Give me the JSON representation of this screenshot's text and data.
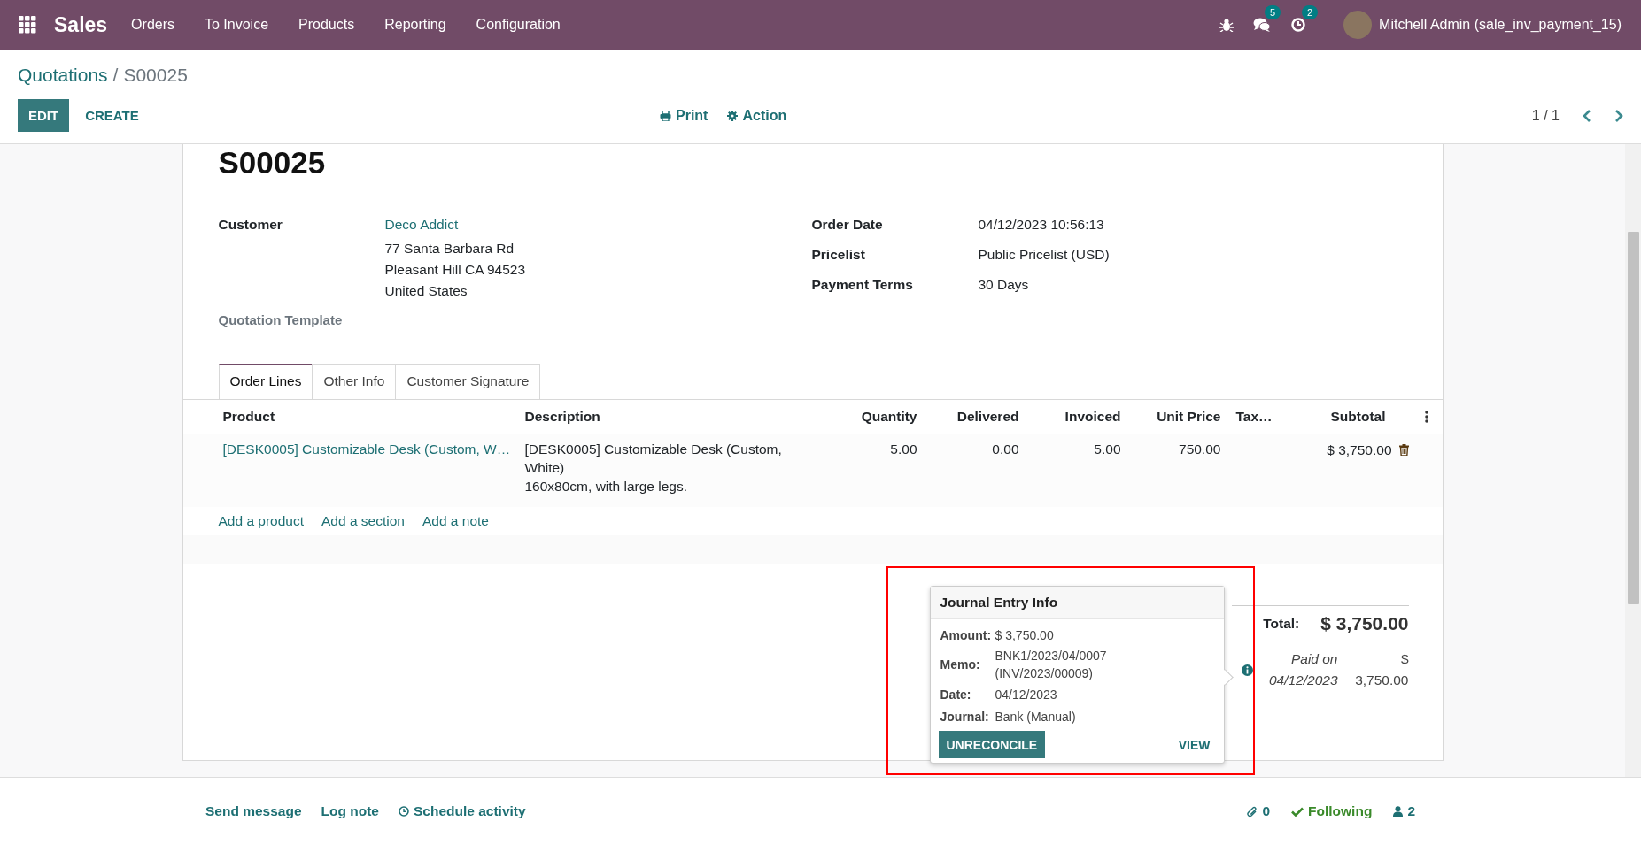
{
  "navbar": {
    "app_name": "Sales",
    "menu": [
      "Orders",
      "To Invoice",
      "Products",
      "Reporting",
      "Configuration"
    ],
    "messages_badge": "5",
    "activities_badge": "2",
    "user": "Mitchell Admin (sale_inv_payment_15)"
  },
  "control_panel": {
    "breadcrumb": {
      "parent": "Quotations",
      "separator": "/",
      "current": "S00025"
    },
    "buttons": [
      {
        "kind": "primary",
        "label": "EDIT"
      },
      {
        "kind": "secondary",
        "label": "CREATE"
      }
    ],
    "actions": [
      {
        "kind": "print",
        "label": "Print"
      },
      {
        "kind": "action",
        "label": "Action"
      }
    ],
    "pager": "1 / 1"
  },
  "sheet": {
    "title": "S00025",
    "customer": {
      "label": "Customer",
      "name": "Deco Addict",
      "address": [
        "77 Santa Barbara Rd",
        "Pleasant Hill CA 94523",
        "United States"
      ]
    },
    "quotation_template": {
      "label": "Quotation Template"
    },
    "fields": [
      {
        "label": "Order Date",
        "value": "04/12/2023 10:56:13"
      },
      {
        "label": "Pricelist",
        "value": "Public Pricelist (USD)"
      },
      {
        "label": "Payment Terms",
        "value": "30 Days"
      }
    ],
    "tabs": [
      {
        "label": "Order Lines",
        "selected": true
      },
      {
        "label": "Other Info",
        "selected": false
      },
      {
        "label": "Customer Signature",
        "selected": false
      }
    ],
    "table": {
      "columns": [
        {
          "label": "Product",
          "kind": "text"
        },
        {
          "label": "Description",
          "kind": "text"
        },
        {
          "label": "Quantity",
          "kind": "number"
        },
        {
          "label": "Delivered",
          "kind": "number"
        },
        {
          "label": "Invoiced",
          "kind": "number"
        },
        {
          "label": "Unit Price",
          "kind": "number"
        },
        {
          "label": "Tax…",
          "kind": "text"
        },
        {
          "label": "Subtotal",
          "kind": "number"
        }
      ],
      "rows": [
        {
          "product": "[DESK0005] Customizable Desk (Custom, W…",
          "description": [
            "[DESK0005] Customizable Desk (Custom, White)",
            "160x80cm, with large legs."
          ],
          "quantity": "5.00",
          "delivered": "0.00",
          "invoiced": "5.00",
          "unit_price": "750.00",
          "subtotal": "$ 3,750.00"
        }
      ],
      "add_links": [
        "Add a product",
        "Add a section",
        "Add a note"
      ]
    },
    "totals": {
      "total_label": "Total:",
      "total_value": "$ 3,750.00",
      "payments": [
        {
          "label": "Paid on 04/12/2023",
          "amount": "$ 3,750.00"
        }
      ]
    }
  },
  "popover": {
    "title": "Journal Entry Info",
    "rows": [
      {
        "label": "Amount:",
        "value": "$ 3,750.00"
      },
      {
        "label": "Memo:",
        "value": "BNK1/2023/04/0007 (INV/2023/00009)"
      },
      {
        "label": "Date:",
        "value": "04/12/2023"
      },
      {
        "label": "Journal:",
        "value": "Bank (Manual)"
      }
    ],
    "buttons": [
      {
        "kind": "primary",
        "label": "UNRECONCILE"
      },
      {
        "kind": "link",
        "label": "VIEW"
      }
    ]
  },
  "chatter": {
    "actions": [
      {
        "kind": "message",
        "label": "Send message"
      },
      {
        "kind": "note",
        "label": "Log note"
      },
      {
        "kind": "activity",
        "label": "Schedule activity"
      }
    ],
    "attachments": "0",
    "following": "Following",
    "followers": "2"
  }
}
